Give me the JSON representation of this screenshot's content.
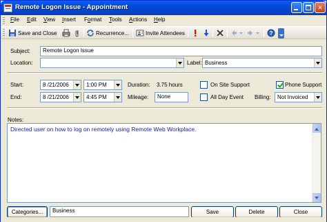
{
  "window": {
    "title": "Remote Logon Issue - Appointment"
  },
  "menu": [
    "File",
    "Edit",
    "View",
    "Insert",
    "Format",
    "Tools",
    "Actions",
    "Help"
  ],
  "menu_mnemonics": [
    "F",
    "E",
    "V",
    "I",
    "o",
    "T",
    "A",
    "H"
  ],
  "toolbar": {
    "save_close_label": "Save and Close",
    "recurrence_label": "Recurrence...",
    "invite_label": "Invite Attendees",
    "icons": [
      "save-icon",
      "print-icon",
      "attach-icon",
      "recurrence-icon",
      "invite-attendees-icon",
      "importance-high-icon",
      "importance-low-icon",
      "delete-icon",
      "previous-item-icon",
      "next-item-icon",
      "help-icon"
    ]
  },
  "form": {
    "subject_label": "Subject:",
    "subject_value": "Remote Logon Issue",
    "location_label": "Location:",
    "location_value": "",
    "label_label": "Label:",
    "label_value": "Business",
    "start_label": "Start:",
    "start_date": "8 /21/2006",
    "start_time": "1:00 PM",
    "end_label": "End:",
    "end_date": "8 /21/2006",
    "end_time": "4:45 PM",
    "duration_label": "Duration:",
    "duration_value": "3.75 hours",
    "mileage_label": "Mileage:",
    "mileage_value": "None",
    "onsite_label": "On Site Support",
    "onsite_checked": false,
    "phone_label": "Phone Support",
    "phone_checked": true,
    "allday_label": "All Day Event",
    "allday_checked": false,
    "billing_label": "Billing:",
    "billing_value": "Not Invoiced",
    "notes_label": "Notes:",
    "notes_value": "Directed user on how to log on remotely using Remote Web Workplace."
  },
  "footer": {
    "categories_button": "Categories...",
    "categories_value": "Business",
    "save_button": "Save",
    "delete_button": "Delete",
    "close_button": "Close"
  },
  "colors": {
    "titlebar": "#0648d8",
    "chrome": "#ece9d8",
    "notes_text": "#2020a0",
    "field_border": "#7f9db9"
  }
}
